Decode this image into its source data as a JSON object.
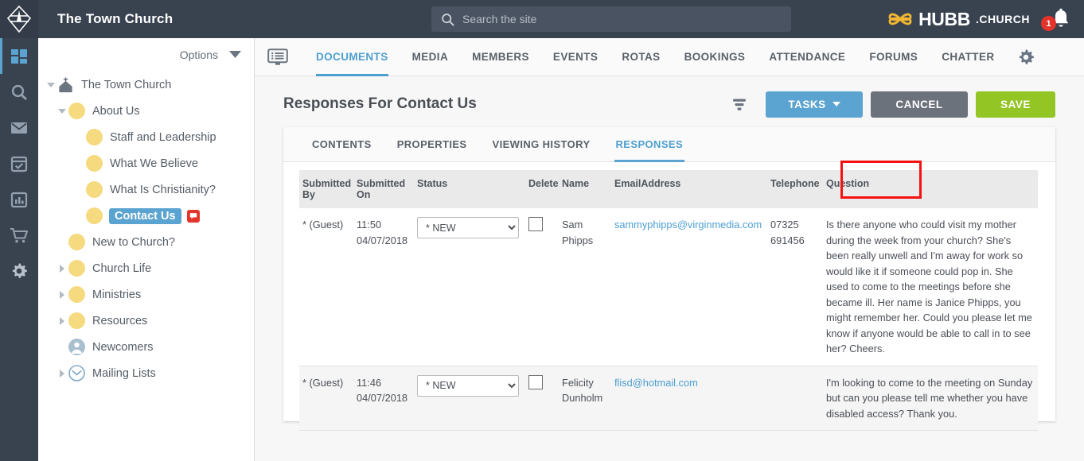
{
  "topbar": {
    "app_title": "The Town Church",
    "search": {
      "placeholder": "Search the site",
      "value": "",
      "icon": "search-icon"
    },
    "brand": {
      "name": "HUBB",
      "tld": ".CHURCH",
      "logo_color": "#f2b632"
    },
    "notifications": {
      "count": "1",
      "icon": "bell-icon",
      "badge_color": "#e3332b"
    }
  },
  "rail": {
    "items": [
      {
        "icon": "dashboard-icon",
        "active": true
      },
      {
        "icon": "search-icon",
        "active": false
      },
      {
        "icon": "mail-icon",
        "active": false
      },
      {
        "icon": "calendar-check-icon",
        "active": false
      },
      {
        "icon": "bar-chart-icon",
        "active": false
      },
      {
        "icon": "shopping-cart-icon",
        "active": false
      },
      {
        "icon": "gear-icon",
        "active": false
      }
    ]
  },
  "sidebar": {
    "options_label": "Options",
    "tree": [
      {
        "label": "The Town Church",
        "indent": 0,
        "caret": "down",
        "icon": "church-icon",
        "selected": false
      },
      {
        "label": "About Us",
        "indent": 1,
        "caret": "down",
        "icon": "page-dot",
        "selected": false
      },
      {
        "label": "Staff and Leadership",
        "indent": 2,
        "caret": "none",
        "icon": "page-dot",
        "selected": false
      },
      {
        "label": "What We Believe",
        "indent": 2,
        "caret": "none",
        "icon": "page-dot",
        "selected": false
      },
      {
        "label": "What Is Christianity?",
        "indent": 2,
        "caret": "none",
        "icon": "page-dot",
        "selected": false
      },
      {
        "label": "Contact Us",
        "indent": 2,
        "caret": "none",
        "icon": "page-dot",
        "selected": true,
        "badge": "comment-icon"
      },
      {
        "label": "New to Church?",
        "indent": 1,
        "caret": "none",
        "icon": "page-dot",
        "selected": false
      },
      {
        "label": "Church Life",
        "indent": 1,
        "caret": "right",
        "icon": "page-dot",
        "selected": false
      },
      {
        "label": "Ministries",
        "indent": 1,
        "caret": "right",
        "icon": "page-dot",
        "selected": false
      },
      {
        "label": "Resources",
        "indent": 1,
        "caret": "right",
        "icon": "page-dot",
        "selected": false
      },
      {
        "label": "Newcomers",
        "indent": 1,
        "caret": "none",
        "icon": "person-icon",
        "selected": false
      },
      {
        "label": "Mailing Lists",
        "indent": 1,
        "caret": "right",
        "icon": "envelope-circle-icon",
        "selected": false
      }
    ]
  },
  "navbar": {
    "icon": "documents-monitor-icon",
    "tabs": [
      {
        "label": "DOCUMENTS",
        "active": true
      },
      {
        "label": "MEDIA",
        "active": false
      },
      {
        "label": "MEMBERS",
        "active": false
      },
      {
        "label": "EVENTS",
        "active": false
      },
      {
        "label": "ROTAS",
        "active": false
      },
      {
        "label": "BOOKINGS",
        "active": false
      },
      {
        "label": "ATTENDANCE",
        "active": false
      },
      {
        "label": "FORUMS",
        "active": false
      },
      {
        "label": "CHATTER",
        "active": false
      }
    ],
    "settings_icon": "gear-icon"
  },
  "page": {
    "title": "Responses For Contact Us",
    "filter_icon": "filter-icon",
    "buttons": {
      "tasks": "TASKS",
      "cancel": "CANCEL",
      "save": "SAVE",
      "tasks_color": "#5ba3d0",
      "cancel_color": "#6b727c",
      "save_color": "#93c524"
    }
  },
  "subtabs": [
    {
      "label": "CONTENTS",
      "active": false
    },
    {
      "label": "PROPERTIES",
      "active": false
    },
    {
      "label": "VIEWING HISTORY",
      "active": false
    },
    {
      "label": "RESPONSES",
      "active": true,
      "highlighted": true
    }
  ],
  "table": {
    "headers": [
      "Submitted By",
      "Submitted On",
      "Status",
      "Delete",
      "Name",
      "EmailAddress",
      "Telephone",
      "Question"
    ],
    "rows": [
      {
        "submitted_by": "* (Guest)",
        "submitted_on": "11:50 04/07/2018",
        "status": "* NEW",
        "delete_checked": false,
        "name": "Sam Phipps",
        "email": "sammyphipps@virginmedia.com",
        "telephone": "07325 691456",
        "question": "Is there anyone who could visit my mother during the week from your church? She's been really unwell and I'm away for work so would like it if someone could pop in. She used to come to the meetings before she became ill. Her name is Janice Phipps, you might remember her. Could you please let me know if anyone would be able to call in to see her? Cheers."
      },
      {
        "submitted_by": "* (Guest)",
        "submitted_on": "11:46 04/07/2018",
        "status": "* NEW",
        "delete_checked": false,
        "name": "Felicity Dunholm",
        "email": "flisd@hotmail.com",
        "telephone": "",
        "question": "I'm looking to come to the meeting on Sunday but can you please tell me whether you have disabled access? Thank you."
      }
    ],
    "status_options": [
      "* NEW"
    ]
  }
}
